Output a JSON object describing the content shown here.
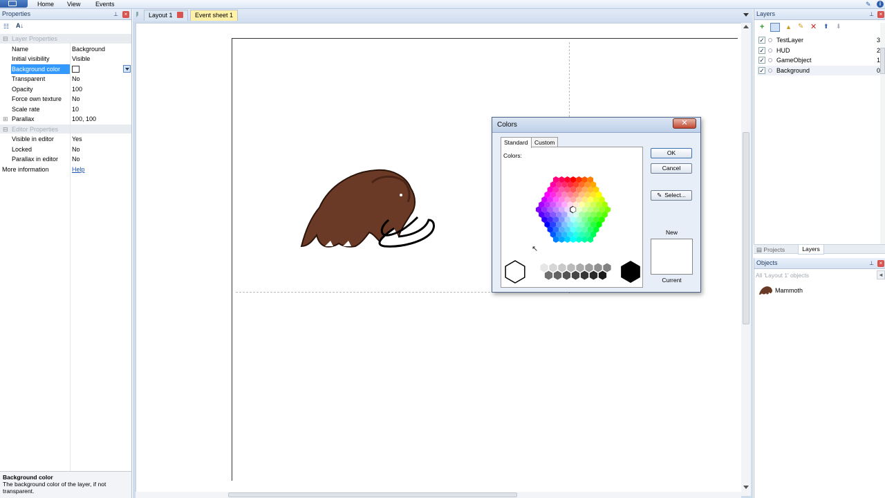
{
  "menubar": {
    "items": [
      "Home",
      "View",
      "Events"
    ]
  },
  "properties": {
    "title": "Properties",
    "rows": [
      {
        "type": "cat",
        "label": "Layer Properties"
      },
      {
        "type": "prop",
        "label": "Name",
        "value": "Background"
      },
      {
        "type": "prop",
        "label": "Initial visibility",
        "value": "Visible"
      },
      {
        "type": "prop",
        "label": "Background color",
        "value": "",
        "selected": true
      },
      {
        "type": "prop",
        "label": "Transparent",
        "value": "No"
      },
      {
        "type": "prop",
        "label": "Opacity",
        "value": "100"
      },
      {
        "type": "prop",
        "label": "Force own texture",
        "value": "No"
      },
      {
        "type": "prop",
        "label": "Scale rate",
        "value": "10"
      },
      {
        "type": "prop",
        "label": "Parallax",
        "value": "100, 100"
      },
      {
        "type": "cat",
        "label": "Editor Properties"
      },
      {
        "type": "prop",
        "label": "Visible in editor",
        "value": "Yes"
      },
      {
        "type": "prop",
        "label": "Locked",
        "value": "No"
      },
      {
        "type": "prop",
        "label": "Parallax in editor",
        "value": "No"
      },
      {
        "type": "link",
        "label": "More information",
        "value": "Help"
      }
    ],
    "description": {
      "title": "Background color",
      "text": "The background color of the layer, if not transparent."
    }
  },
  "tabs": [
    {
      "label": "Layout 1"
    },
    {
      "label": "Event sheet 1"
    }
  ],
  "layers": {
    "title": "Layers",
    "rows": [
      {
        "name": "TestLayer",
        "index": "3"
      },
      {
        "name": "HUD",
        "index": "2"
      },
      {
        "name": "GameObject",
        "index": "1"
      },
      {
        "name": "Background",
        "index": "0",
        "selected": true
      }
    ]
  },
  "panel_tabs": [
    "Projects",
    "Layers"
  ],
  "objects": {
    "title": "Objects",
    "filter": "All 'Layout 1' objects",
    "items": [
      "Mammoth"
    ]
  },
  "colors_dialog": {
    "title": "Colors",
    "tab_standard": "Standard",
    "tab_custom": "Custom",
    "colors_label": "Colors:",
    "ok": "OK",
    "cancel": "Cancel",
    "select": "Select...",
    "new_label": "New",
    "current_label": "Current"
  },
  "colors": {
    "accent": "#2c5ea8",
    "tab_active": "#fff7b0",
    "mammoth_brown": "#6b3a26"
  }
}
